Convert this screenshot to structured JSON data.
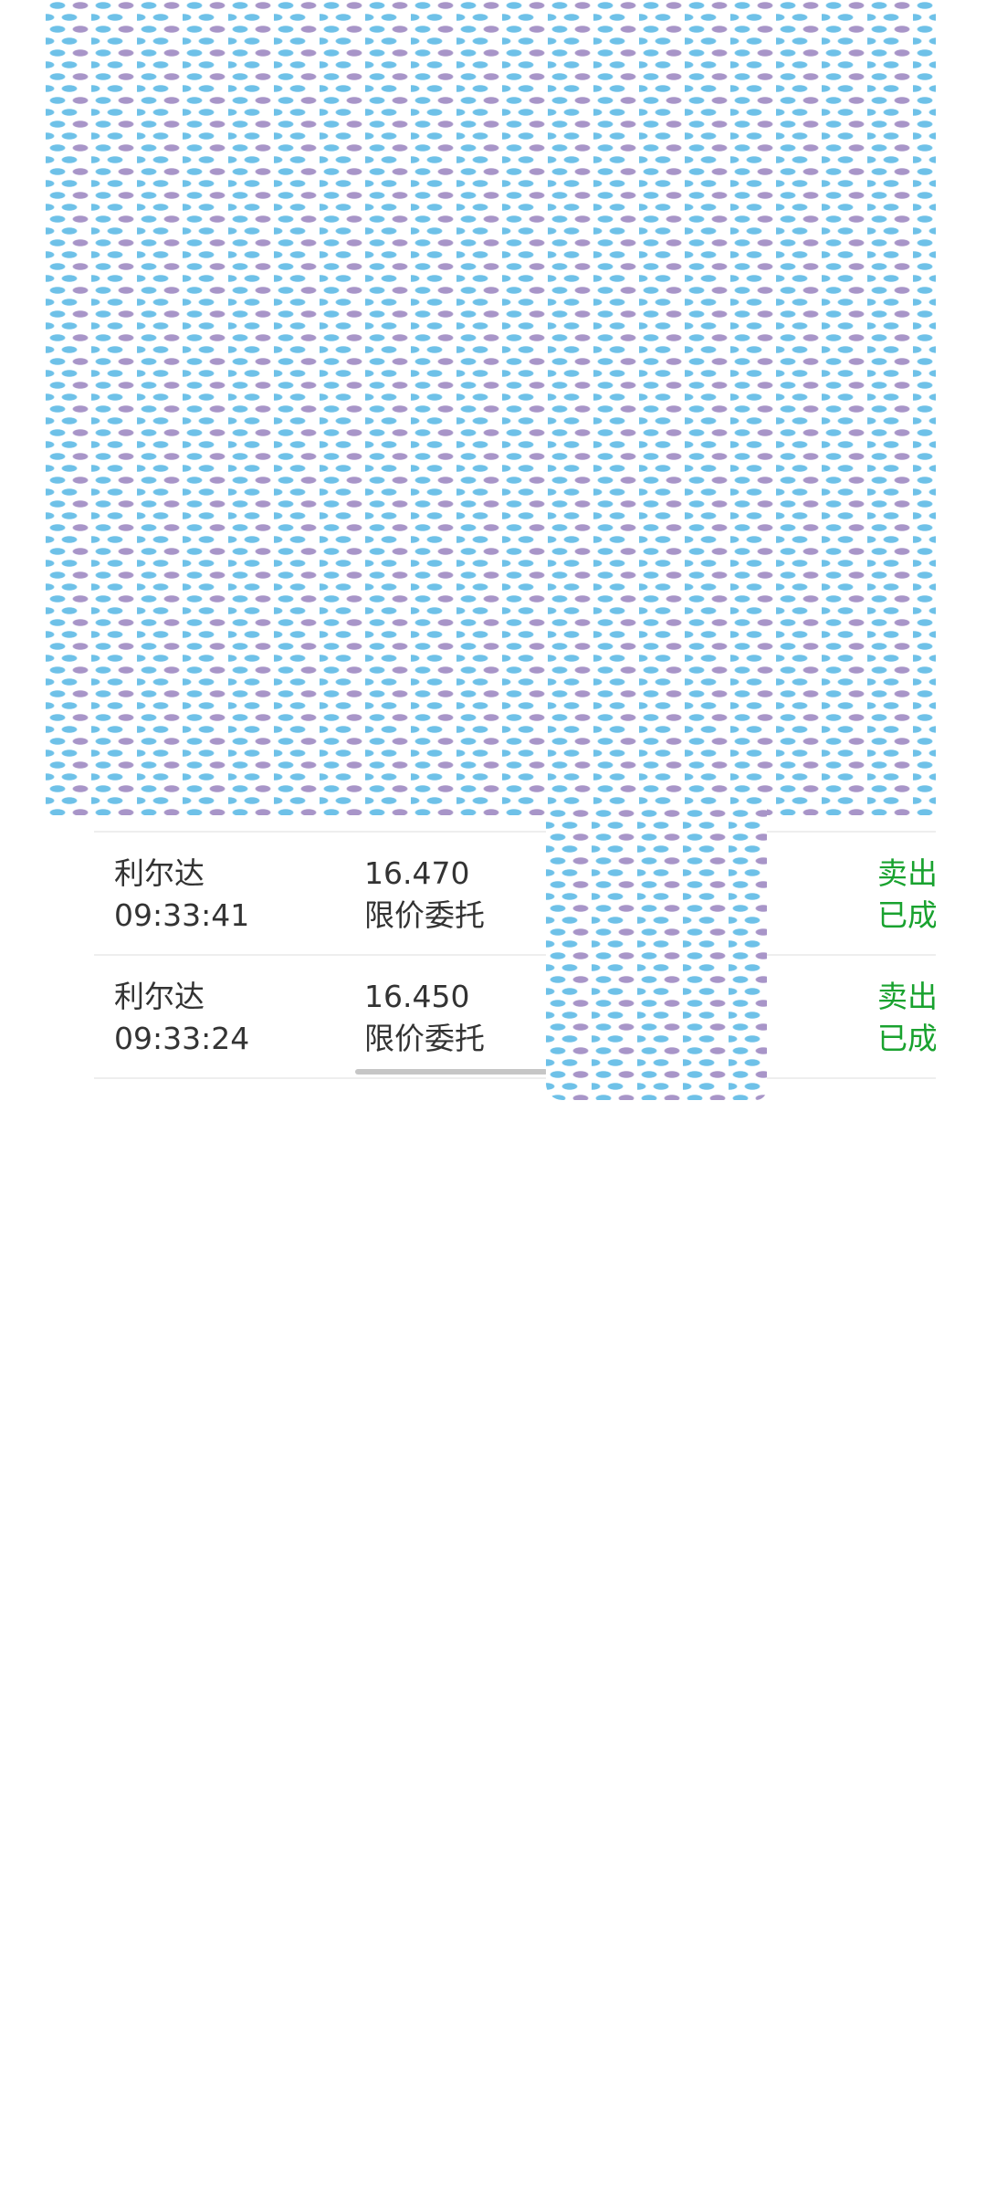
{
  "orders": [
    {
      "name": "利尔达",
      "time": "09:33:41",
      "price": "16.470",
      "order_type": "限价委托",
      "direction": "卖出",
      "status": "已成"
    },
    {
      "name": "利尔达",
      "time": "09:33:24",
      "price": "16.450",
      "order_type": "限价委托",
      "direction": "卖出",
      "status": "已成"
    }
  ],
  "colors": {
    "sell_status": "#19a22f",
    "text": "#333333",
    "mosaic_blue": "#6ec1e8",
    "mosaic_purple": "#a895c8"
  }
}
